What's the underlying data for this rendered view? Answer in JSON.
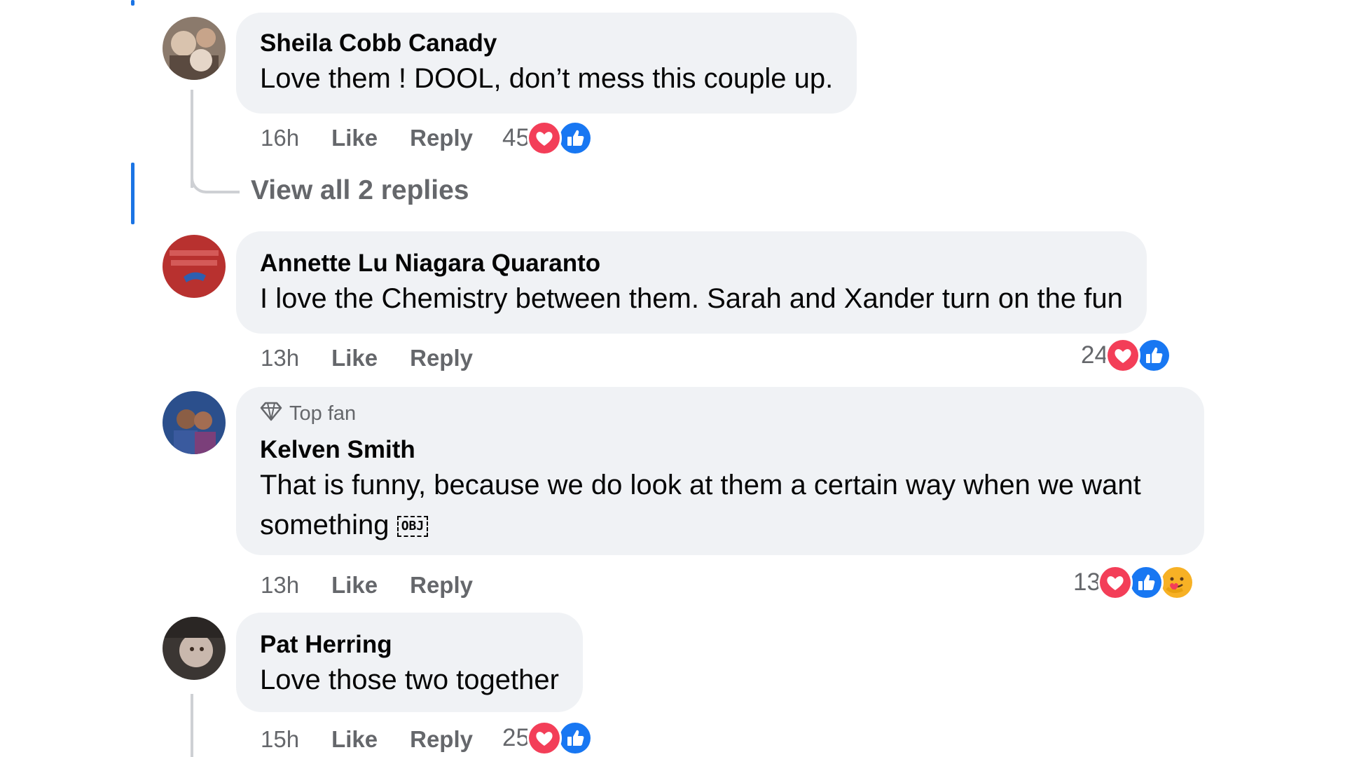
{
  "comments": [
    {
      "author": "Sheila Cobb Canady",
      "text": "Love them ! DOOL, don’t mess this couple up.",
      "time": "16h",
      "like": "Like",
      "reply": "Reply",
      "reaction_count": "45",
      "reactions": [
        "heart-icon",
        "thumbs-up-icon"
      ]
    },
    {
      "author": "Annette Lu Niagara Quaranto",
      "text": "I love the Chemistry between them. Sarah and Xander turn on the fun",
      "time": "13h",
      "like": "Like",
      "reply": "Reply",
      "reaction_count": "24",
      "reactions": [
        "heart-icon",
        "thumbs-up-icon"
      ]
    },
    {
      "badge": "Top fan",
      "author": "Kelven Smith",
      "text_line1": "That is funny, because we do look at them a certain way when we want",
      "text_line2": "something",
      "obj_glyph": "OBJ",
      "time": "13h",
      "like": "Like",
      "reply": "Reply",
      "reaction_count": "13",
      "reactions": [
        "heart-icon",
        "thumbs-up-icon",
        "care-icon"
      ]
    },
    {
      "author": "Pat Herring",
      "text": "Love those two together",
      "time": "15h",
      "like": "Like",
      "reply": "Reply",
      "reaction_count": "25",
      "reactions": [
        "heart-icon",
        "thumbs-up-icon"
      ]
    }
  ],
  "view_replies": "View all 2 replies",
  "colors": {
    "bubble": "#f0f2f5",
    "meta_text": "#65676b",
    "thread_bar": "#1b74e4",
    "love": "#f33e58",
    "like": "#1877f2"
  }
}
